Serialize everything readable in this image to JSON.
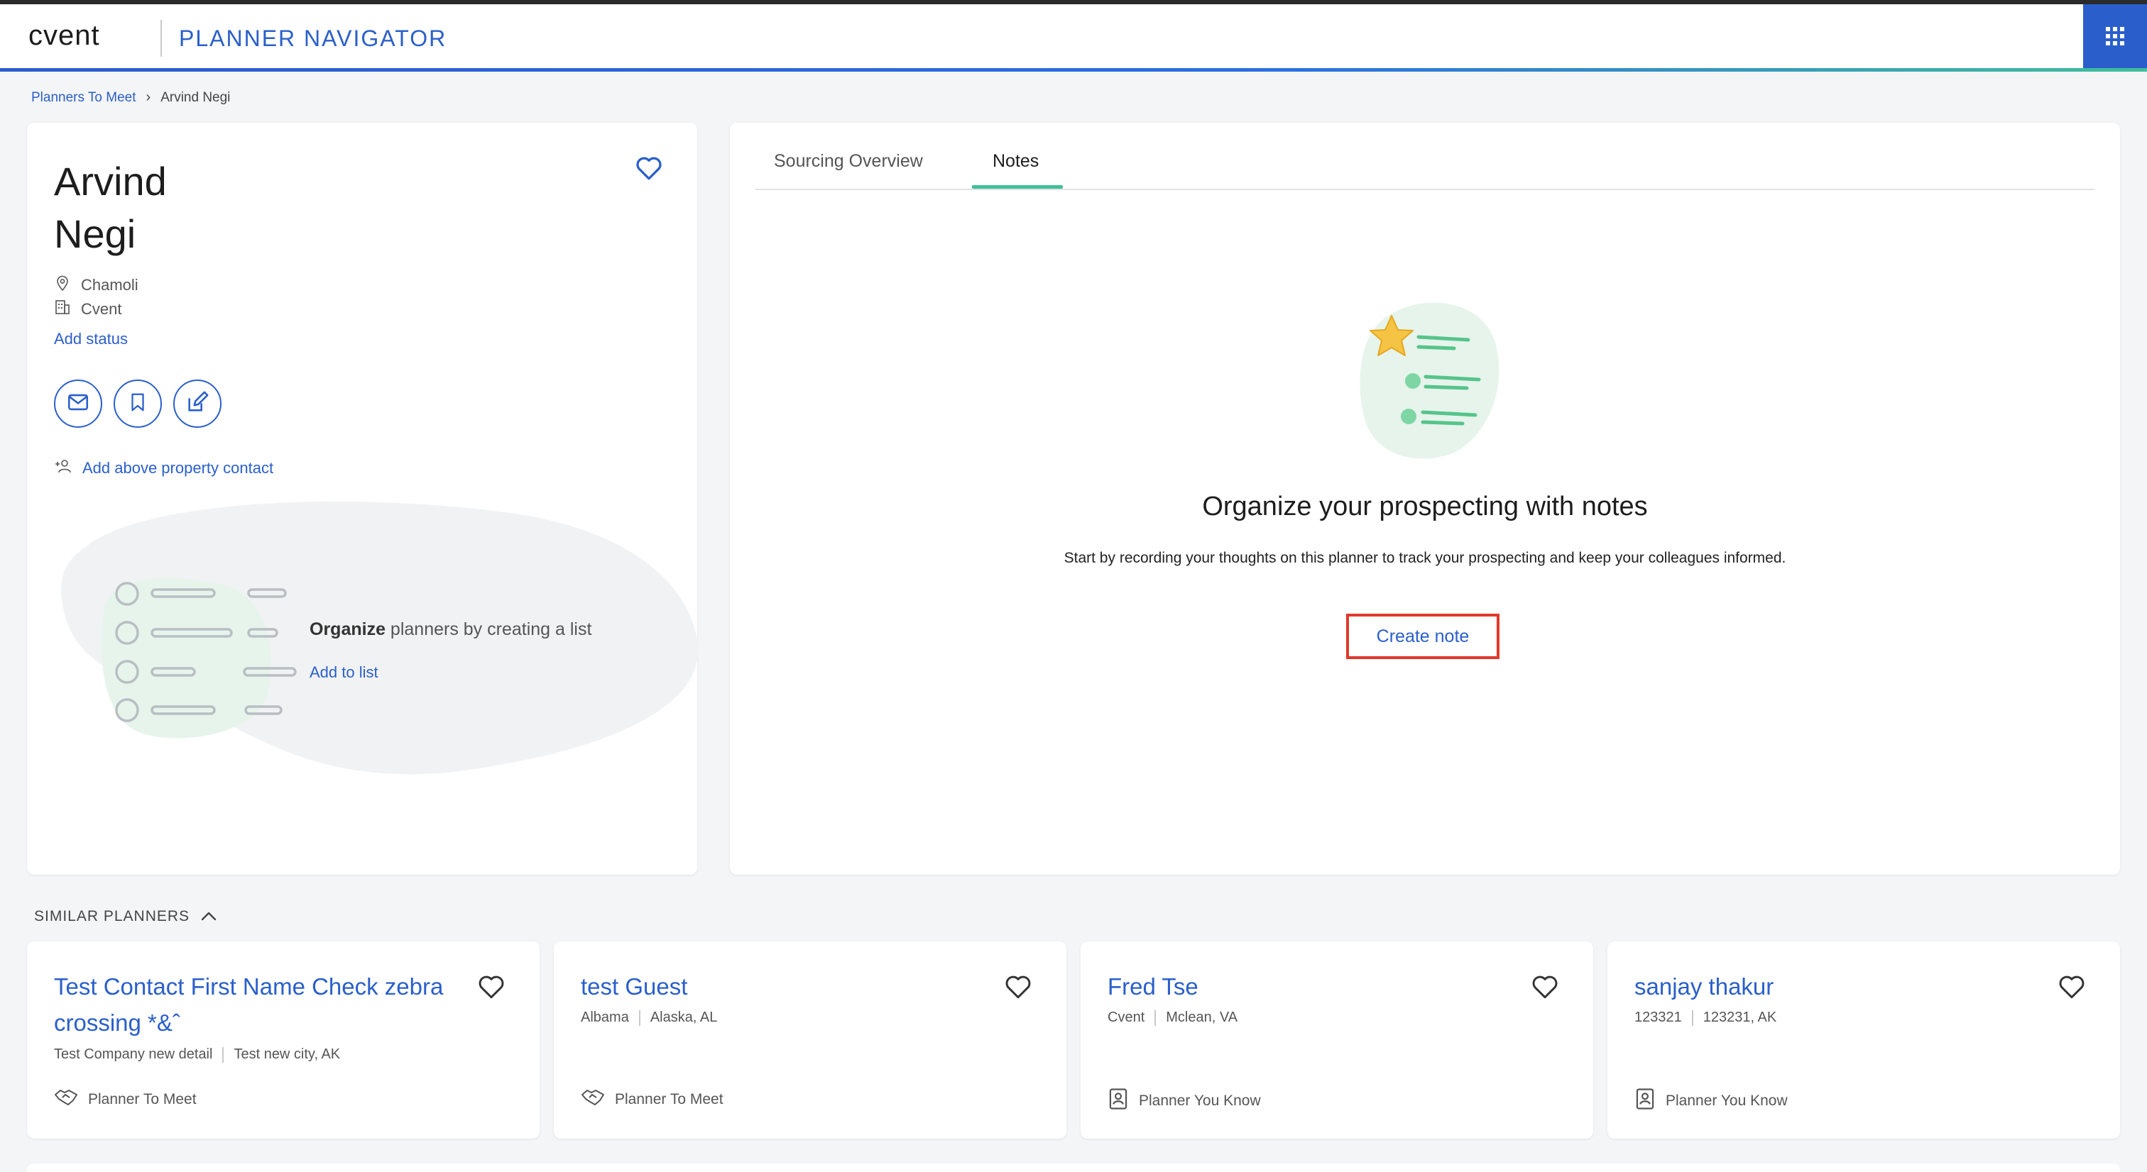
{
  "header": {
    "logo": "cvent",
    "app_title": "PLANNER NAVIGATOR",
    "apps_icon": "apps-grid-icon"
  },
  "breadcrumb": {
    "parent": "Planners To Meet",
    "current": "Arvind Negi"
  },
  "planner": {
    "first_name": "Arvind",
    "last_name": "Negi",
    "location": "Chamoli",
    "company": "Cvent",
    "add_status": "Add status",
    "add_contact": "Add above property contact",
    "organize_bold": "Organize",
    "organize_rest": " planners by creating a list",
    "add_to_list": "Add to list"
  },
  "tabs": [
    {
      "label": "Sourcing Overview",
      "active": false
    },
    {
      "label": "Notes",
      "active": true
    }
  ],
  "notes": {
    "title": "Organize your prospecting with notes",
    "subtitle": "Start by recording your thoughts on this planner to track your prospecting and keep your colleagues informed.",
    "create_button": "Create note"
  },
  "similar": {
    "header": "SIMILAR PLANNERS",
    "cards": [
      {
        "name": "Test Contact First Name Check zebra crossing *&ˆ",
        "company": "Test Company new detail",
        "location": "Test new city, AK",
        "type": "Planner To Meet",
        "type_icon": "handshake-icon"
      },
      {
        "name": "test Guest",
        "company": "Albama",
        "location": "Alaska, AL",
        "type": "Planner To Meet",
        "type_icon": "handshake-icon"
      },
      {
        "name": "Fred Tse",
        "company": "Cvent",
        "location": "Mclean, VA",
        "type": "Planner You Know",
        "type_icon": "contact-book-icon"
      },
      {
        "name": "sanjay thakur",
        "company": "123321",
        "location": "123231, AK",
        "type": "Planner You Know",
        "type_icon": "contact-book-icon"
      }
    ]
  },
  "colors": {
    "accent": "#2a5fcb",
    "tab_underline": "#3fbf9a",
    "highlight_box": "#e0392b"
  }
}
